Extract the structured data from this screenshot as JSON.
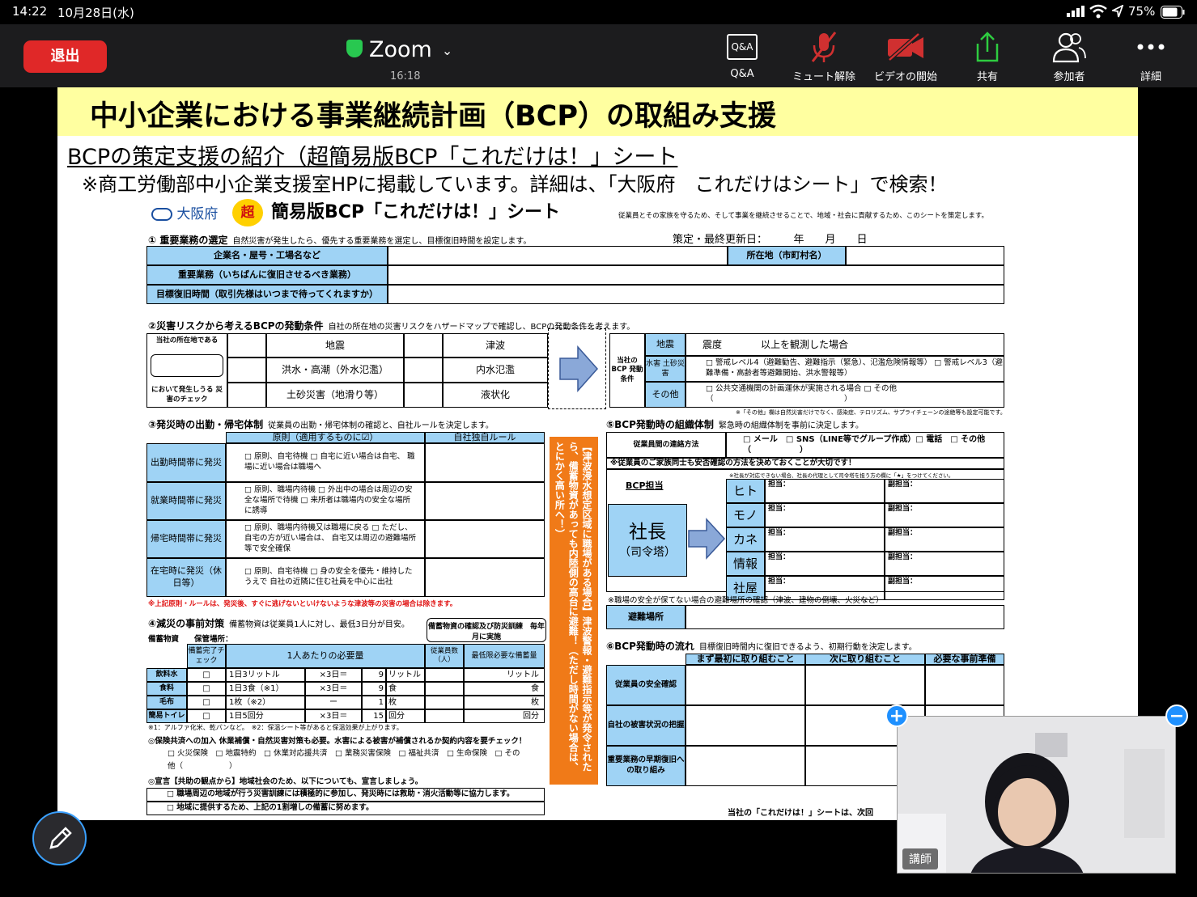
{
  "status": {
    "time": "14:22",
    "date": "10月28日(水)",
    "battery": "75%"
  },
  "topbar": {
    "leave": "退出",
    "title": "Zoom",
    "meeting_time": "16:18",
    "tools": [
      {
        "icon": "qa-icon",
        "label": "Q&A",
        "glyph": "Q&A"
      },
      {
        "icon": "mic-muted-icon",
        "label": "ミュート解除"
      },
      {
        "icon": "video-off-icon",
        "label": "ビデオの開始"
      },
      {
        "icon": "share-icon",
        "label": "共有"
      },
      {
        "icon": "participants-icon",
        "label": "参加者"
      },
      {
        "icon": "more-icon",
        "label": "詳細"
      }
    ]
  },
  "slide": {
    "title": "中小企業における事業継続計画（BCP）の取組み支援",
    "subtitle": "BCPの策定支援の紹介（超簡易版BCP「これだけは！」シート",
    "note": "※商工労働部中小企業支援室HPに掲載しています。詳細は、「大阪府　これだけはシート」で検索！",
    "sheet": {
      "logo": "大阪府",
      "super": "超",
      "header": "簡易版BCP「これだけは！」シート",
      "purpose": "従業員とその家族を守るため、そして事業を継続させることで、地域・社会に貢献するため、このシートを策定します。",
      "s1": {
        "title": "① 重要業務の選定",
        "desc": "自然災害が発生したら、優先する重要業務を選定し、目標復旧時間を設定します。",
        "updated": "策定・最終更新日：　　　年　　月　　日",
        "rows": [
          "企業名・屋号・工場名など",
          "重要業務（いちばんに復旧させるべき業務）",
          "目標復旧時間（取引先様はいつまで待ってくれますか）"
        ],
        "location": "所在地（市町村名）"
      },
      "s2": {
        "title": "②災害リスクから考えるBCPの発動条件",
        "desc": "自社の所在地の災害リスクをハザードマップで確認し、BCPの発動条件を考えます。",
        "left_top": "当社の所在地である",
        "left_bottom": "において発生しうる 災害のチェック",
        "risks": [
          "地震",
          "津波",
          "洪水・高潮（外水氾濫）",
          "内水氾濫",
          "土砂災害（地滑り等）",
          "液状化"
        ],
        "trigger_label": "当社の BCP 発動条件",
        "triggers": [
          {
            "k": "地震",
            "v": "震度　　　　以上を観測した場合"
          },
          {
            "k": "水害 土砂災害",
            "v": "□ 警戒レベル4（避難勧告、避難指示（緊急）、氾濫危険情報等） □ 警戒レベル3（避難準備・高齢者等避難開始、洪水警報等）"
          },
          {
            "k": "その他",
            "v": "□ 公共交通機関の計画運休が実施される場合 □ その他（　　　　　　　　　　　　　　　　　）"
          }
        ],
        "footnote": "※「その他」欄は自然災害だけでなく、感染症、テロリズム、サプライチェーンの途絶等も設定可能です。"
      },
      "s3": {
        "title": "③発災時の出勤・帰宅体制",
        "desc": "従業員の出勤・帰宅体制の確認と、自社ルールを決定します。",
        "col1": "原則（適用するものに☑）",
        "col2": "自社独自ルール",
        "rows": [
          {
            "label": "出勤時間帯に発災",
            "items": "□ 原則、自宅待機 □ 自宅に近い場合は自宅、 職場に近い場合は職場へ"
          },
          {
            "label": "就業時間帯に発災",
            "items": "□ 原則、職場内待機 □ 外出中の場合は周辺の安全な場所で待機 □ 来所者は職場内の安全な場所に誘導"
          },
          {
            "label": "帰宅時間帯に発災",
            "items": "□ 原則、職場内待機又は職場に戻る □ ただし、自宅の方が近い場合は、 自宅又は周辺の避難場所等で安全確保"
          },
          {
            "label": "在宅時に発災（休日等）",
            "items": "□ 原則、自宅待機 □ 身の安全を優先・維持したうえで 自社の近隣に住む社員を中心に出社"
          }
        ],
        "warning": "※上記原則・ルールは、発災後、すぐに逃げないといけないような津波等の災害の場合は除きます。"
      },
      "s4": {
        "title": "④減災の事前対策",
        "desc": "備蓄物資は従業員1人に対し、最低3日分が目安。",
        "stock_label": "備蓄物資　　保管場所：",
        "check_box": "備蓄物資の確認及び防災訓練　毎年　　月に実施",
        "cols": [
          "備蓄完了チェック",
          "1人あたりの必要量",
          "従業員数（人）",
          "最低限必要な備蓄量"
        ],
        "rows": [
          {
            "item": "飲料水",
            "amt": "1日3リットル",
            "mul": "×3日＝",
            "n": "9",
            "unit": "リットル",
            "tail": "リットル"
          },
          {
            "item": "食料",
            "amt": "1日3食（※1）",
            "mul": "×3日＝",
            "n": "9",
            "unit": "食",
            "tail": "食"
          },
          {
            "item": "毛布",
            "amt": "1枚（※2）",
            "mul": "ー",
            "n": "1",
            "unit": "枚",
            "tail": "枚"
          },
          {
            "item": "簡易トイレ",
            "amt": "1日5回分",
            "mul": "×3日＝",
            "n": "15",
            "unit": "回分",
            "tail": "回分"
          }
        ],
        "fn": "※1：アルファ化米、乾パンなど。　※2：保温シート等があると保温効果が上がります。",
        "insurance": "◎保険共済への加入 休業補償・自然災害対策も必要。水害による被害が補償されるか契約内容を要チェック！",
        "ins_items": "□ 火災保険　□ 地震特約　□ 休業対応援共済　□ 業務災害保険　□ 福祉共済　□ 生命保険　□ その他（　　　　　　）",
        "declare": "◎宣言【共助の観点から】地域社会のため、以下についても、宣言しましょう。",
        "decl_items": [
          "□ 職場周辺の地域が行う災害訓練には積極的に参加し、発災時には救助・消火活動等に協力します。",
          "□ 地域に提供するため、上記の1割増しの備蓄に努めます。"
        ]
      },
      "orange": "【津波浸水想定区域に職場がある場合】津波警報・避難指示等が発令されたら、備蓄物資があっても内陸側の高台に避難！（ただし時間がない場合は、とにかく高い所へ！）",
      "s5": {
        "title": "⑤BCP発動時の組織体制",
        "desc": "緊急時の組織体制を事前に決定します。",
        "contact": "従業員間の連絡方法",
        "contact_items": "□ メール　□ SNS（LINE等でグループ作成）□ 電話　□ その他（　　　　　　）",
        "family": "※従業員のご家族同士も安否確認の方法を決めておくことが大切です！",
        "fn": "※社長が対応できない場合、社長の代理として司令塔を担う方の欄に「★」をつけてください。",
        "bcp": "BCP担当",
        "boss": "社長",
        "boss_sub": "（司令塔）",
        "roles": [
          "ヒト",
          "モノ",
          "カネ",
          "情報",
          "社屋"
        ],
        "charge": "担当：",
        "sub": "副担当：",
        "evac_note": "※職場の安全が保てない場合の避難場所の確認（津波、建物の倒壊、火災など）",
        "evac": "避難場所"
      },
      "s6": {
        "title": "⑥BCP発動時の流れ",
        "desc": "目標復旧時間内に復旧できるよう、初期行動を決定します。",
        "cols": [
          "まず最初に取り組むこと",
          "次に取り組むこと",
          "必要な事前準備"
        ],
        "rows": [
          "従業員の安全確認",
          "自社の被害状況の把握",
          "重要業務の早期復旧への取り組み"
        ],
        "footer": "当社の「これだけは！」シートは、次回"
      }
    }
  },
  "video": {
    "name": "講師"
  },
  "controls": {
    "plus": "+",
    "minus": "−"
  }
}
